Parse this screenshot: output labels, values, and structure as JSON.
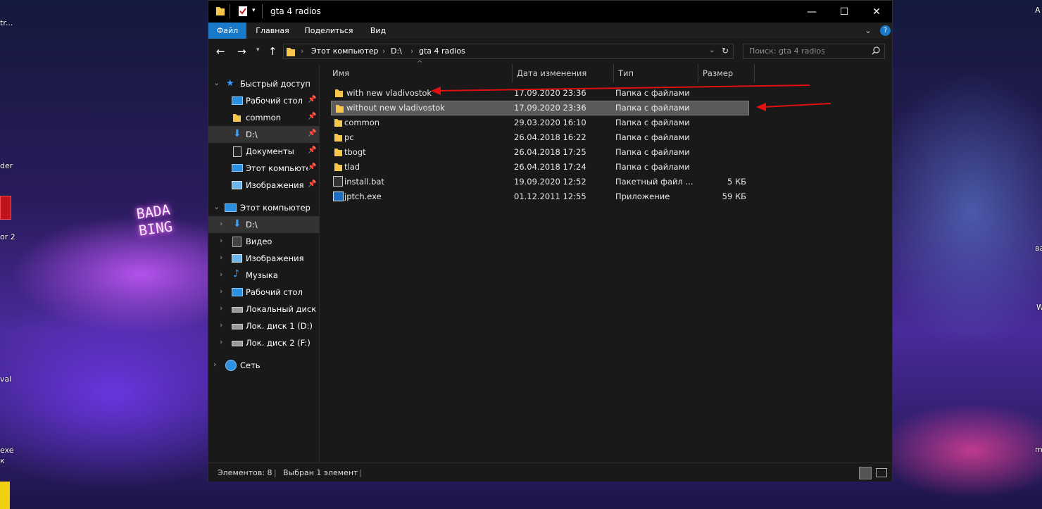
{
  "desktop": {
    "labels": [
      "tr...",
      "der",
      "or 2",
      "val",
      "exe",
      "к",
      "A",
      "ва",
      "W",
      "m"
    ],
    "neon_sign": "BADA BING"
  },
  "window": {
    "title": "gta 4 radios",
    "controls": {
      "minimize": "—",
      "maximize": "☐",
      "close": "✕"
    }
  },
  "ribbon": {
    "tabs": [
      "Файл",
      "Главная",
      "Поделиться",
      "Вид"
    ],
    "help": "?"
  },
  "address": {
    "crumbs": [
      "Этот компьютер",
      "D:\\",
      "gta 4 radios"
    ],
    "search_placeholder": "Поиск: gta 4 radios"
  },
  "nav": {
    "quick_access": "Быстрый доступ",
    "quick_items": [
      {
        "label": "Рабочий стол",
        "icon": "desktop-icon",
        "pinned": true
      },
      {
        "label": "common",
        "icon": "folder-icon",
        "pinned": true
      },
      {
        "label": "D:\\",
        "icon": "download-icon",
        "pinned": true
      },
      {
        "label": "Документы",
        "icon": "documents-icon",
        "pinned": true
      },
      {
        "label": "Этот компьютер",
        "icon": "computer-icon",
        "pinned": true
      },
      {
        "label": "Изображения",
        "icon": "pictures-icon",
        "pinned": true
      }
    ],
    "this_pc": "Этот компьютер",
    "pc_items": [
      {
        "label": "D:\\",
        "icon": "download-icon"
      },
      {
        "label": "Видео",
        "icon": "video-icon"
      },
      {
        "label": "Изображения",
        "icon": "pictures-icon"
      },
      {
        "label": "Музыка",
        "icon": "music-icon"
      },
      {
        "label": "Рабочий стол",
        "icon": "desktop-icon"
      },
      {
        "label": "Локальный диск (C",
        "icon": "drive-icon"
      },
      {
        "label": "Лок. диск 1 (D:)",
        "icon": "drive-icon"
      },
      {
        "label": "Лок. диск 2 (F:)",
        "icon": "drive-icon"
      }
    ],
    "network": "Сеть"
  },
  "list": {
    "columns": [
      "Имя",
      "Дата изменения",
      "Тип",
      "Размер"
    ],
    "rows": [
      {
        "name": "with new vladivostok",
        "date": "17.09.2020 23:36",
        "type": "Папка с файлами",
        "size": "",
        "icon": "folder-icon"
      },
      {
        "name": "without new vladivostok",
        "date": "17.09.2020 23:36",
        "type": "Папка с файлами",
        "size": "",
        "icon": "folder-icon",
        "selected": true
      },
      {
        "name": "common",
        "date": "29.03.2020 16:10",
        "type": "Папка с файлами",
        "size": "",
        "icon": "folder-icon"
      },
      {
        "name": "pc",
        "date": "26.04.2018 16:22",
        "type": "Папка с файлами",
        "size": "",
        "icon": "folder-icon"
      },
      {
        "name": "tbogt",
        "date": "26.04.2018 17:25",
        "type": "Папка с файлами",
        "size": "",
        "icon": "folder-icon"
      },
      {
        "name": "tlad",
        "date": "26.04.2018 17:24",
        "type": "Папка с файлами",
        "size": "",
        "icon": "folder-icon"
      },
      {
        "name": "install.bat",
        "date": "19.09.2020 12:52",
        "type": "Пакетный файл ...",
        "size": "5 КБ",
        "icon": "batch-file-icon"
      },
      {
        "name": "jptch.exe",
        "date": "01.12.2011 12:55",
        "type": "Приложение",
        "size": "59 КБ",
        "icon": "exe-file-icon"
      }
    ]
  },
  "status": {
    "items_count": "Элементов: 8",
    "selected": "Выбран 1 элемент"
  },
  "colors": {
    "accent": "#1979ca",
    "folder": "#f5c84c",
    "annotation_arrow": "#e01010"
  }
}
